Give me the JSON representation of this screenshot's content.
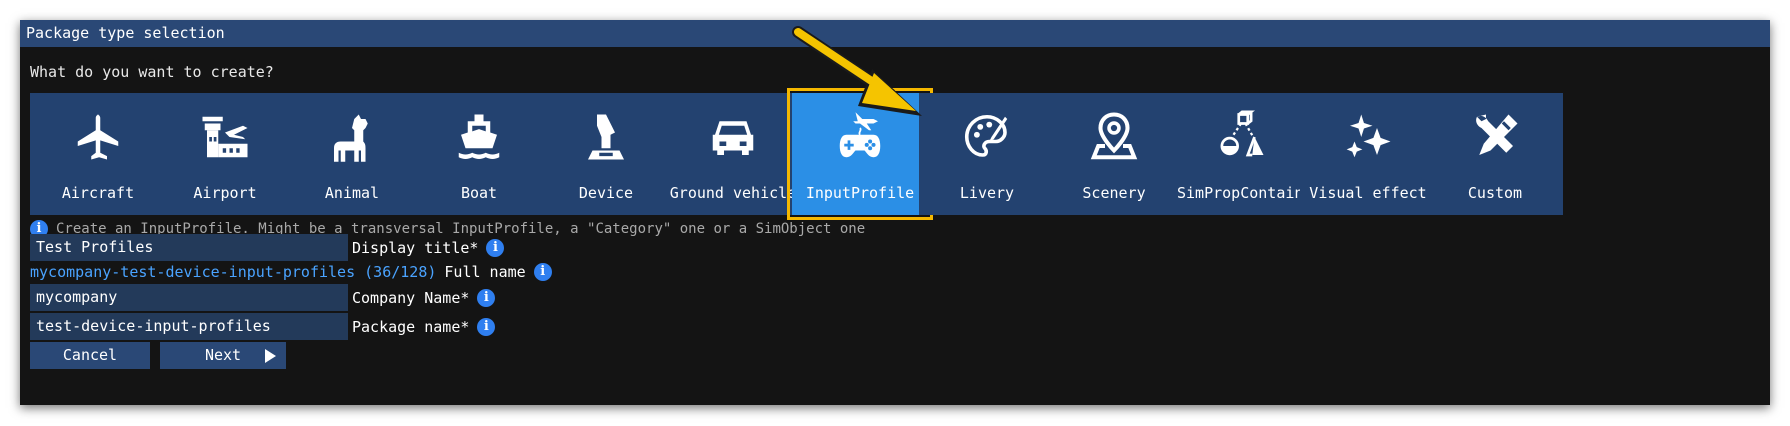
{
  "window": {
    "title": "Package type selection"
  },
  "question": "What do you want to create?",
  "tiles": [
    {
      "label": "Aircraft",
      "icon": "airplane-icon"
    },
    {
      "label": "Airport",
      "icon": "airport-tower-icon"
    },
    {
      "label": "Animal",
      "icon": "llama-icon"
    },
    {
      "label": "Boat",
      "icon": "ship-icon"
    },
    {
      "label": "Device",
      "icon": "joystick-icon"
    },
    {
      "label": "Ground vehicle",
      "icon": "car-icon"
    },
    {
      "label": "InputProfile",
      "icon": "gamepad-plane-icon",
      "selected": true
    },
    {
      "label": "Livery",
      "icon": "palette-icon"
    },
    {
      "label": "Scenery",
      "icon": "map-pin-icon"
    },
    {
      "label": "SimPropContainer",
      "icon": "shapes-icon"
    },
    {
      "label": "Visual effect",
      "icon": "sparkles-icon"
    },
    {
      "label": "Custom",
      "icon": "tools-icon"
    }
  ],
  "hint": "Create an InputProfile. Might be a transversal InputProfile, a \"Category\" one or a SimObject one",
  "form": {
    "display_title": {
      "value": "Test Profiles",
      "label": "Display title*"
    },
    "full_name": {
      "value": "mycompany-test-device-input-profiles (36/128)",
      "label": "Full name"
    },
    "company_name": {
      "value": "mycompany",
      "label": "Company Name*"
    },
    "package_name": {
      "value": "test-device-input-profiles",
      "label": "Package name*"
    }
  },
  "buttons": {
    "cancel": "Cancel",
    "next": "Next"
  },
  "colors": {
    "accent": "#2b8fe6",
    "tile": "#234270",
    "highlight": "#f5b800",
    "link": "#4aa3ff"
  }
}
